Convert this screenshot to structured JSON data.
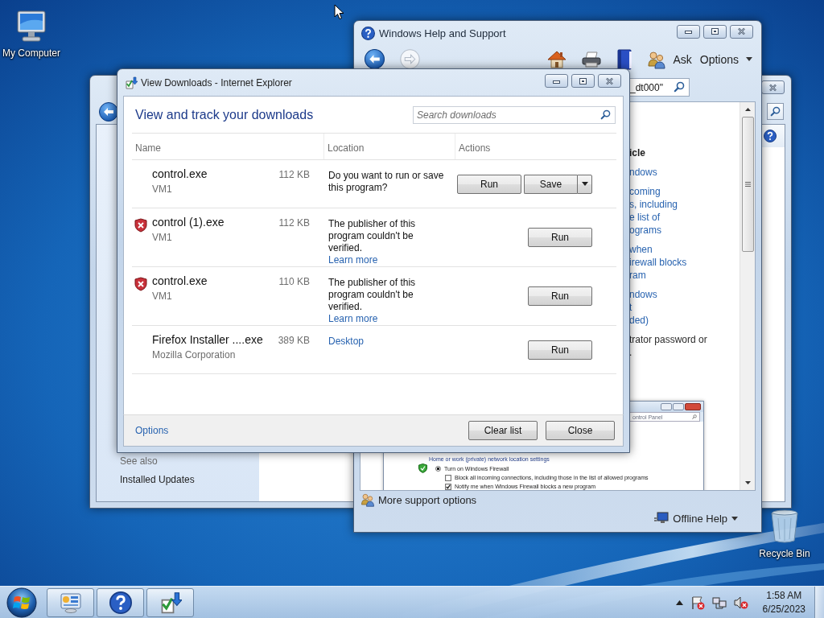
{
  "desktop_icons": [
    {
      "label": "My Computer",
      "kind": "computer"
    },
    {
      "label": "Recycle Bin",
      "kind": "recycle-bin"
    }
  ],
  "control_panel_window": {
    "side_pane": {
      "heading": "See also",
      "links": [
        "Installed Updates"
      ]
    }
  },
  "help_window": {
    "title": "Windows Help and Support",
    "toolbar": {
      "ask": "Ask",
      "options": "Options"
    },
    "search": {
      "value": "_dt000\""
    },
    "article": [
      {
        "kind": "heading",
        "lines": [
          "icle"
        ]
      },
      {
        "kind": "link",
        "lines": [
          "ndows"
        ]
      },
      {
        "kind": "link",
        "lines": [
          "coming",
          "s, including",
          "e list of",
          "ograms"
        ]
      },
      {
        "kind": "link",
        "lines": [
          "when",
          "irewall blocks",
          "ram"
        ]
      },
      {
        "kind": "link",
        "lines": [
          "ndows",
          "t",
          "ded)"
        ]
      },
      {
        "kind": "text",
        "lines": [
          "trator password or",
          "."
        ]
      }
    ],
    "screenshot": {
      "search_value": "ontrol Panel",
      "section": "Home or work (private) network location settings",
      "options": [
        {
          "kind": "radio",
          "label": "Turn on Windows Firewall",
          "selected": true
        },
        {
          "kind": "checkbox",
          "label": "Block all incoming connections, including those in the list of allowed programs",
          "checked": false
        },
        {
          "kind": "checkbox",
          "label": "Notify me when Windows Firewall blocks a new program",
          "checked": true
        }
      ]
    },
    "footer": {
      "support": "More support options",
      "offline": "Offline Help"
    }
  },
  "downloads_window": {
    "title": "View Downloads - Internet Explorer",
    "heading": "View and track your downloads",
    "search": {
      "placeholder": "Search downloads"
    },
    "columns": [
      "Name",
      "Location",
      "Actions"
    ],
    "rows": [
      {
        "name": "control.exe",
        "size": "112 KB",
        "source": "VM1",
        "blocked": false,
        "location": {
          "kind": "message",
          "text": "Do you want to run or save\nthis program?"
        },
        "actions": [
          {
            "kind": "button",
            "label": "Run"
          },
          {
            "kind": "split",
            "label": "Save"
          }
        ]
      },
      {
        "name": "control (1).exe",
        "size": "112 KB",
        "source": "VM1",
        "blocked": true,
        "location": {
          "kind": "message",
          "text": "The publisher of this\nprogram couldn't be\nverified.",
          "link": "Learn more"
        },
        "actions": [
          {
            "kind": "button",
            "label": "Run"
          }
        ]
      },
      {
        "name": "control.exe",
        "size": "110 KB",
        "source": "VM1",
        "blocked": true,
        "location": {
          "kind": "message",
          "text": "The publisher of this\nprogram couldn't be\nverified.",
          "link": "Learn more"
        },
        "actions": [
          {
            "kind": "button",
            "label": "Run"
          }
        ]
      },
      {
        "name": "Firefox Installer ....exe",
        "size": "389 KB",
        "source": "Mozilla Corporation",
        "blocked": false,
        "location": {
          "kind": "link",
          "text": "Desktop"
        },
        "actions": [
          {
            "kind": "button",
            "label": "Run"
          }
        ]
      }
    ],
    "footer": {
      "options": "Options",
      "buttons": [
        "Clear list",
        "Close"
      ]
    }
  },
  "taskbar": {
    "clock": {
      "time": "1:58 AM",
      "date": "6/25/2023"
    }
  }
}
